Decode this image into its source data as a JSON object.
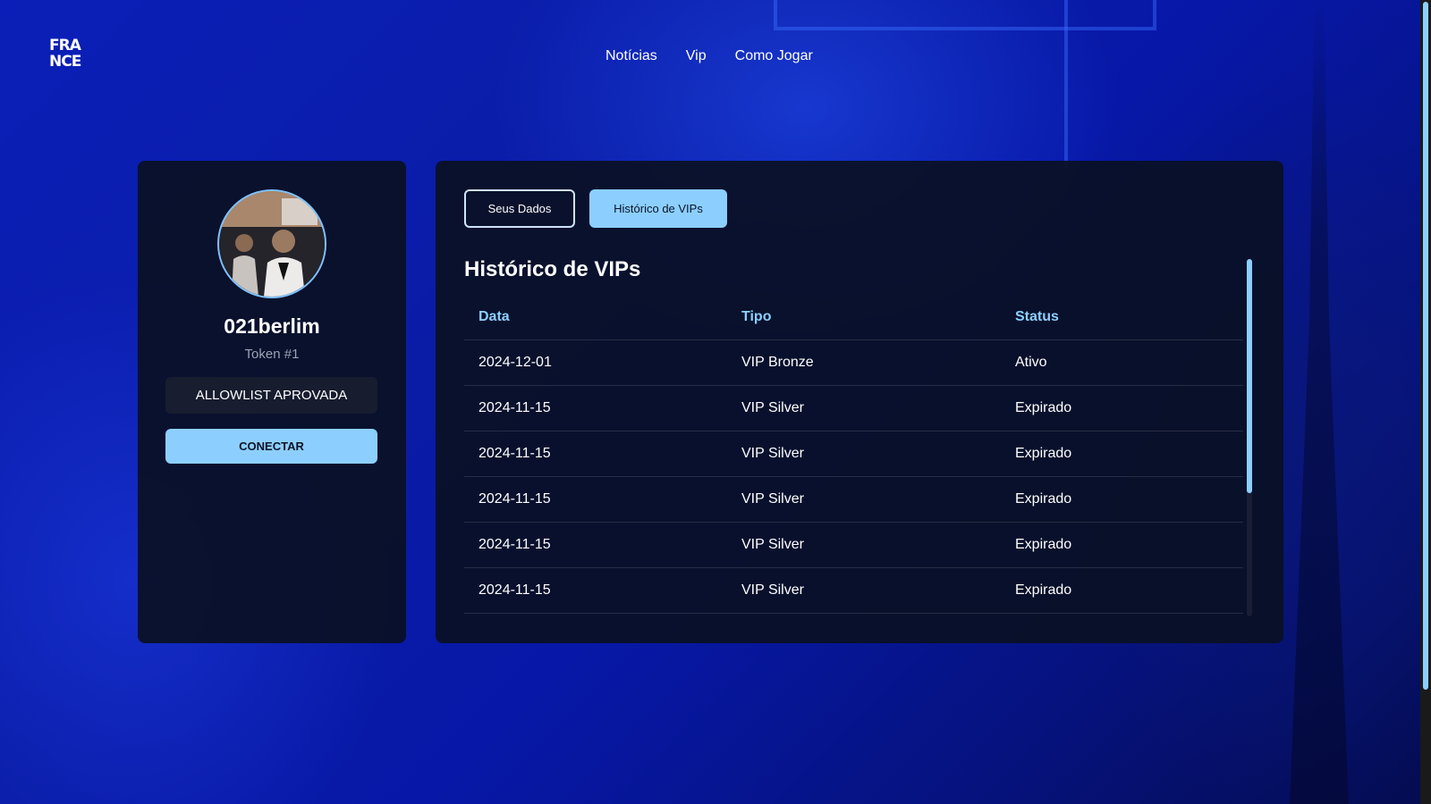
{
  "brand": {
    "logo_line1": "FRA",
    "logo_line2": "NCE"
  },
  "nav": {
    "items": [
      "Notícias",
      "Vip",
      "Como Jogar"
    ]
  },
  "profile": {
    "username": "021berlim",
    "token": "Token #1",
    "allowlist": "ALLOWLIST APROVADA",
    "connect_label": "CONECTAR"
  },
  "tabs": [
    "Seus Dados",
    "Histórico de VIPs"
  ],
  "active_tab": "Histórico de VIPs",
  "history": {
    "title": "Histórico de VIPs",
    "columns": [
      "Data",
      "Tipo",
      "Status"
    ],
    "rows": [
      [
        "2024-12-01",
        "VIP Bronze",
        "Ativo"
      ],
      [
        "2024-11-15",
        "VIP Silver",
        "Expirado"
      ],
      [
        "2024-11-15",
        "VIP Silver",
        "Expirado"
      ],
      [
        "2024-11-15",
        "VIP Silver",
        "Expirado"
      ],
      [
        "2024-11-15",
        "VIP Silver",
        "Expirado"
      ],
      [
        "2024-11-15",
        "VIP Silver",
        "Expirado"
      ]
    ]
  },
  "colors": {
    "accent": "#8ccfff",
    "panel": "#0a1024",
    "background": "#0b1fb8"
  }
}
